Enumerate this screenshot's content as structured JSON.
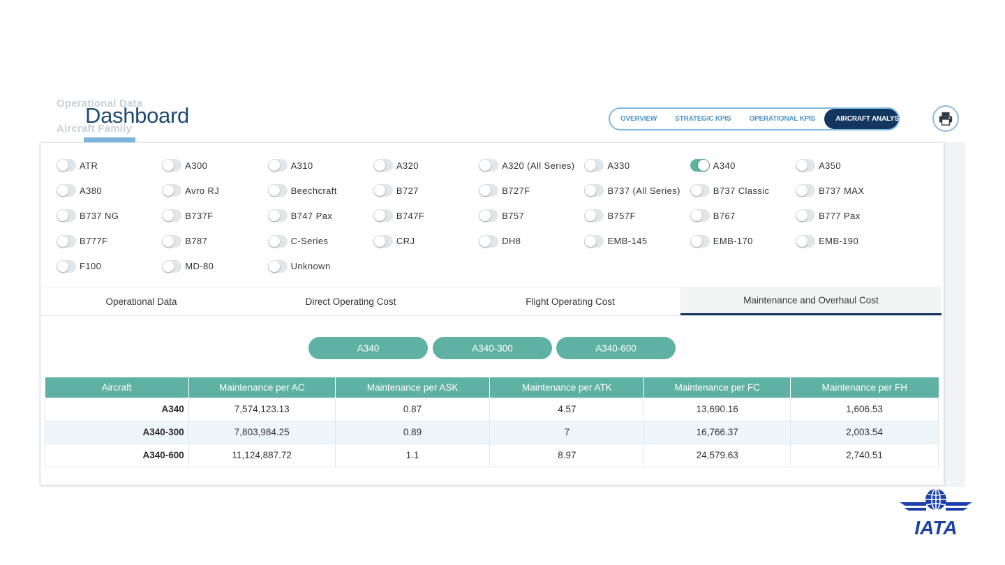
{
  "background_labels": [
    "Operational Data",
    "Aircraft Family"
  ],
  "page_title": "Dashboard",
  "nav": {
    "items": [
      "OVERVIEW",
      "STRATEGIC KPIS",
      "OPERATIONAL KPIS",
      "AIRCRAFT ANALYSIS"
    ],
    "active": "AIRCRAFT ANALYSIS"
  },
  "print_icon": "printer-icon",
  "aircraft_toggles": [
    [
      {
        "label": "ATR",
        "on": false
      },
      {
        "label": "A300",
        "on": false
      },
      {
        "label": "A310",
        "on": false
      },
      {
        "label": "A320",
        "on": false
      },
      {
        "label": "A320 (All Series)",
        "on": false
      },
      {
        "label": "A330",
        "on": false
      },
      {
        "label": "A340",
        "on": true
      },
      {
        "label": "A350",
        "on": false
      }
    ],
    [
      {
        "label": "A380",
        "on": false
      },
      {
        "label": "Avro RJ",
        "on": false
      },
      {
        "label": "Beechcraft",
        "on": false
      },
      {
        "label": "B727",
        "on": false
      },
      {
        "label": "B727F",
        "on": false
      },
      {
        "label": "B737 (All Series)",
        "on": false
      },
      {
        "label": "B737 Classic",
        "on": false
      },
      {
        "label": "B737 MAX",
        "on": false
      }
    ],
    [
      {
        "label": "B737 NG",
        "on": false
      },
      {
        "label": "B737F",
        "on": false
      },
      {
        "label": "B747 Pax",
        "on": false
      },
      {
        "label": "B747F",
        "on": false
      },
      {
        "label": "B757",
        "on": false
      },
      {
        "label": "B757F",
        "on": false
      },
      {
        "label": "B767",
        "on": false
      },
      {
        "label": "B777 Pax",
        "on": false
      }
    ],
    [
      {
        "label": "B777F",
        "on": false
      },
      {
        "label": "B787",
        "on": false
      },
      {
        "label": "C-Series",
        "on": false
      },
      {
        "label": "CRJ",
        "on": false
      },
      {
        "label": "DH8",
        "on": false
      },
      {
        "label": "EMB-145",
        "on": false
      },
      {
        "label": "EMB-170",
        "on": false
      },
      {
        "label": "EMB-190",
        "on": false
      }
    ],
    [
      {
        "label": "F100",
        "on": false
      },
      {
        "label": "MD-80",
        "on": false
      },
      {
        "label": "Unknown",
        "on": false
      }
    ]
  ],
  "tabs": [
    "Operational Data",
    "Direct Operating Cost",
    "Flight Operating Cost",
    "Maintenance and Overhaul Cost"
  ],
  "active_tab": "Maintenance and Overhaul Cost",
  "variants": [
    "A340",
    "A340-300",
    "A340-600"
  ],
  "table": {
    "headers": [
      "Aircraft",
      "Maintenance per AC",
      "Maintenance per ASK",
      "Maintenance per ATK",
      "Maintenance per FC",
      "Maintenance per FH"
    ],
    "rows": [
      [
        "A340",
        "7,574,123.13",
        "0.87",
        "4.57",
        "13,690.16",
        "1,606.53"
      ],
      [
        "A340-300",
        "7,803,984.25",
        "0.89",
        "7",
        "16,766.37",
        "2,003.54"
      ],
      [
        "A340-600",
        "11,124,887.72",
        "1.1",
        "8.97",
        "24,579.63",
        "2,740.51"
      ]
    ]
  },
  "logo": {
    "text": "IATA",
    "icon": "iata-globe-wings-logo"
  },
  "colors": {
    "accent_teal": "#5fb1a3",
    "navy": "#12365f",
    "nav_border": "#7bb8e0"
  }
}
